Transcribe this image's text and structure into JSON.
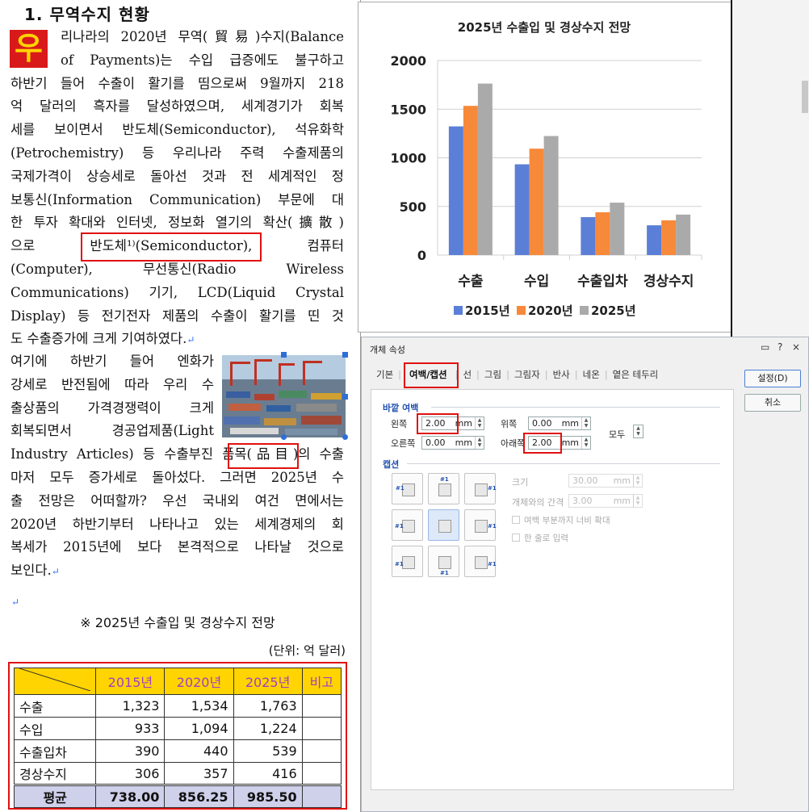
{
  "doc": {
    "heading": "1. 무역수지 현황",
    "dropcap": "우",
    "para1": [
      "리나라의 2020년 무역(貿易)수지(Balance",
      "of Payments)는 수입 급증에도 불구하고",
      "하반기 들어 수출이 활기를 띰으로써 9월까지 218",
      "억 달러의 흑자를 달성하였으며, 세계경기가 회복",
      "세를 보이면서 반도체(Semiconductor), 석유화학",
      "(Petrochemistry) 등 우리나라 주력 수출제품의",
      "국제가격이 상승세로 돌아선 것과 전 세계적인 정",
      "보통신(Information Communication) 부문에 대",
      "한 투자 확대와 인터넷, 정보화 열기의 확산(擴散)",
      "으로|반도체¹⁾(Semiconductor),|컴퓨터",
      "(Computer), 무선통신(Radio Wireless",
      "Communications) 기기, LCD(Liquid Crystal",
      "Display) 등 전기전자 제품의 수출이 활기를 띤 것",
      "도 수출증가에 크게 기여하였다."
    ],
    "para2": [
      "  여기에 하반기 들어 엔화가",
      "강세로 반전됨에 따라 우리 수",
      "출상품의 가격경쟁력이 크게",
      "회복되면서 경공업제품(Light",
      "Industry Articles) 등 수출부진 품목(品目)의 수출",
      "마저 모두 증가세로 돌아섰다. 그러면 2025년 수",
      "출 전망은 어떠할까? 우선 국내외 여건 면에서는",
      "2020년 하반기부터 나타나고 있는 세계경제의 회",
      "복세가 2015년에 보다 본격적으로 나타날 것으로",
      "보인다."
    ],
    "caption": "※ 2025년 수출입 및 경상수지 전망",
    "unit": "(단위: 억 달러)",
    "table": {
      "headers": [
        "",
        "2015년",
        "2020년",
        "2025년",
        "비고"
      ],
      "rows": [
        [
          "수출",
          "1,323",
          "1,534",
          "1,763",
          ""
        ],
        [
          "수입",
          "933",
          "1,094",
          "1,224",
          ""
        ],
        [
          "수출입차",
          "390",
          "440",
          "539",
          ""
        ],
        [
          "경상수지",
          "306",
          "357",
          "416",
          ""
        ]
      ],
      "avg": [
        "평균",
        "738.00",
        "856.25",
        "985.50",
        ""
      ]
    }
  },
  "chart_data": {
    "type": "bar",
    "title": "2025년 수출입 및 경상수지 전망",
    "categories": [
      "수출",
      "수입",
      "수출입차",
      "경상수지"
    ],
    "series": [
      {
        "name": "2015년",
        "values": [
          1323,
          933,
          390,
          306
        ],
        "color": "#5b7fd6"
      },
      {
        "name": "2020년",
        "values": [
          1534,
          1094,
          440,
          357
        ],
        "color": "#f7893a"
      },
      {
        "name": "2025년",
        "values": [
          1763,
          1224,
          539,
          416
        ],
        "color": "#aaaaaa"
      }
    ],
    "yticks": [
      0,
      500,
      1000,
      1500,
      2000
    ],
    "ylim": [
      0,
      2000
    ],
    "grid": true,
    "legend": "bottom"
  },
  "dialog": {
    "title": "개체 속성",
    "controls": [
      "▭",
      "?",
      "×"
    ],
    "tabs": [
      "기본",
      "여백/캡션",
      "선",
      "그림",
      "그림자",
      "반사",
      "네온",
      "옅은 테두리"
    ],
    "active_tab": "여백/캡션",
    "ok": "설정(D)",
    "cancel": "취소",
    "margin_section": "바깥 여백",
    "left_label": "왼쪽",
    "left_value": "2.00",
    "top_label": "위쪽",
    "top_value": "0.00",
    "right_label": "오른쪽",
    "right_value": "0.00",
    "bottom_label": "아래쪽",
    "bottom_value": "2.00",
    "all_label": "모두",
    "unit": "mm",
    "caption_section": "캡션",
    "size_label": "크기",
    "size_value": "30.00",
    "gap_label": "개체와의 간격",
    "gap_value": "3.00",
    "check1": "여백 부분까지 너비 확대",
    "check2": "한 줄로 입력",
    "caption_tag": "#1"
  }
}
